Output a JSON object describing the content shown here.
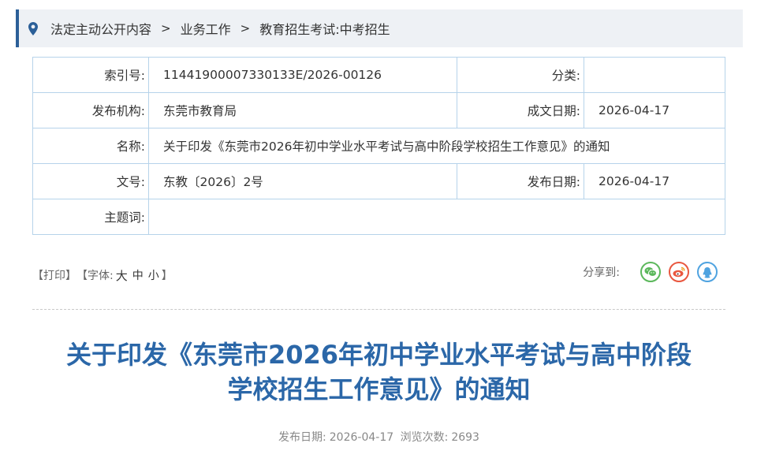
{
  "breadcrumb": {
    "items": [
      "法定主动公开内容",
      "业务工作",
      "教育招生考试:中考招生"
    ],
    "separator": ">"
  },
  "info": {
    "index_label": "索引号:",
    "index_value": "11441900007330133E/2026-00126",
    "category_label": "分类:",
    "category_value": "",
    "issuer_label": "发布机构:",
    "issuer_value": "东莞市教育局",
    "created_label": "成文日期:",
    "created_value": "2026-04-17",
    "name_label": "名称:",
    "name_value": "关于印发《东莞市2026年初中学业水平考试与高中阶段学校招生工作意见》的通知",
    "docno_label": "文号:",
    "docno_value": "东教〔2026〕2号",
    "published_label": "发布日期:",
    "published_value": "2026-04-17",
    "keywords_label": "主题词:",
    "keywords_value": ""
  },
  "toolbar": {
    "print": "【打印】",
    "font_open": "【字体:",
    "font_large": "大",
    "font_medium": "中",
    "font_small": "小",
    "font_close": "】",
    "share_label": "分享到:"
  },
  "article": {
    "title_line1": "关于印发《东莞市2026年初中学业水平考试与高中阶段",
    "title_line2": "学校招生工作意见》的通知",
    "meta_date_label": "发布日期:",
    "meta_date": "2026-04-17",
    "meta_views_label": "浏览次数:",
    "meta_views": "2693"
  },
  "colors": {
    "accent": "#2b5f98",
    "title": "#2b67a8",
    "table_border": "#b6d3ea",
    "wechat": "#5cb85c",
    "weibo": "#e9573f",
    "qq": "#4fa3e0"
  }
}
